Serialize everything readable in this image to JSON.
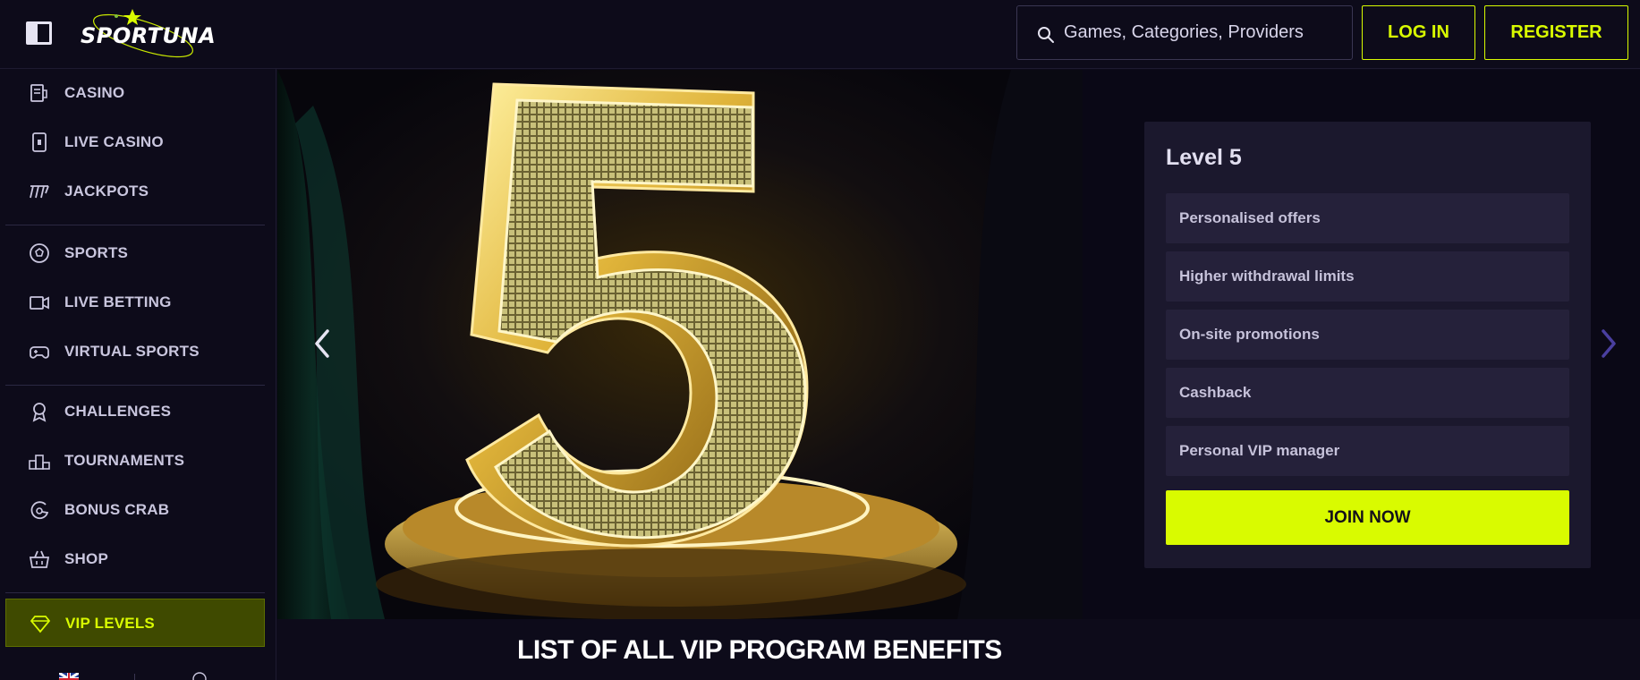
{
  "header": {
    "logo_text": "SPORTUNA",
    "search_placeholder": "Games, Categories, Providers",
    "login_label": "LOG IN",
    "register_label": "REGISTER"
  },
  "sidebar": {
    "items": [
      {
        "label": "CASINO",
        "icon": "casino-icon"
      },
      {
        "label": "LIVE CASINO",
        "icon": "live-casino-icon"
      },
      {
        "label": "JACKPOTS",
        "icon": "jackpots-icon"
      },
      {
        "label": "SPORTS",
        "icon": "soccer-ball-icon"
      },
      {
        "label": "LIVE BETTING",
        "icon": "video-camera-icon"
      },
      {
        "label": "VIRTUAL SPORTS",
        "icon": "gamepad-icon"
      },
      {
        "label": "CHALLENGES",
        "icon": "medal-icon"
      },
      {
        "label": "TOURNAMENTS",
        "icon": "podium-icon"
      },
      {
        "label": "BONUS CRAB",
        "icon": "bonus-crab-icon"
      },
      {
        "label": "SHOP",
        "icon": "basket-icon"
      },
      {
        "label": "VIP LEVELS",
        "icon": "diamond-icon",
        "active": true
      }
    ]
  },
  "hero": {
    "level_title": "Level 5",
    "benefits": [
      "Personalised offers",
      "Higher withdrawal limits",
      "On-site promotions",
      "Cashback",
      "Personal VIP manager"
    ],
    "join_label": "JOIN NOW"
  },
  "section_title": "LIST OF ALL VIP PROGRAM BENEFITS",
  "colors": {
    "accent": "#d9fb00",
    "background": "#0d0b1a",
    "card": "#1b182d",
    "benefit_row": "#25213a",
    "active_nav": "#3f4a00"
  }
}
